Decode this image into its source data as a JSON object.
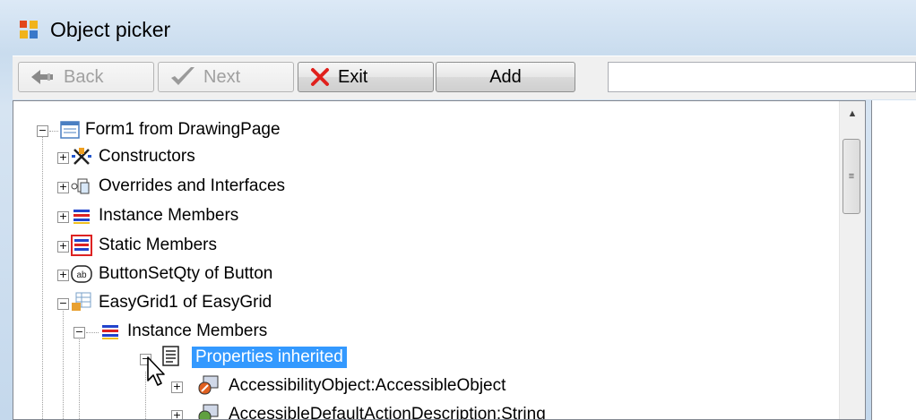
{
  "window": {
    "title": "Object picker"
  },
  "toolbar": {
    "back_label": "Back",
    "next_label": "Next",
    "exit_label": "Exit",
    "add_label": "Add",
    "path_value": ""
  },
  "tree": {
    "items": [
      {
        "label": "Form1 from DrawingPage"
      },
      {
        "label": "Constructors"
      },
      {
        "label": "Overrides and Interfaces"
      },
      {
        "label": "Instance Members"
      },
      {
        "label": "Static Members"
      },
      {
        "label": "ButtonSetQty of Button"
      },
      {
        "label": "EasyGrid1 of EasyGrid"
      },
      {
        "label": "Instance Members"
      },
      {
        "label": "Properties inherited"
      },
      {
        "label": "AccessibilityObject:AccessibleObject"
      },
      {
        "label": "AccessibleDefaultActionDescription:String"
      }
    ]
  },
  "colors": {
    "selection": "#3399ff"
  }
}
